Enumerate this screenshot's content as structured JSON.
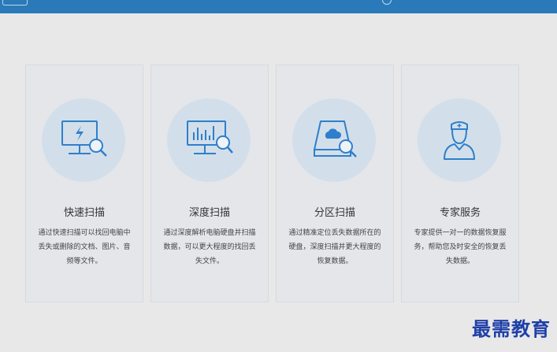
{
  "cards": [
    {
      "title": "快速扫描",
      "desc": "通过快速扫描可以找回电脑中丢失或删除的文档、图片、音频等文件。",
      "icon": "monitor-scan-icon"
    },
    {
      "title": "深度扫描",
      "desc": "通过深度解析电脑硬盘并扫描数据，可以更大程度的找回丢失文件。",
      "icon": "monitor-chart-scan-icon"
    },
    {
      "title": "分区扫描",
      "desc": "通过精准定位丢失数据所在的硬盘，深度扫描并更大程度的恢复数据。",
      "icon": "disk-cloud-scan-icon"
    },
    {
      "title": "专家服务",
      "desc": "专家提供一对一的数据恢复服务，帮助您及时安全的恢复丢失数据。",
      "icon": "doctor-icon"
    }
  ],
  "watermark": "最需教育",
  "colors": {
    "accent": "#2a7ab9",
    "icon": "#2f7fcc",
    "icon_bg": "#d2dfea"
  }
}
